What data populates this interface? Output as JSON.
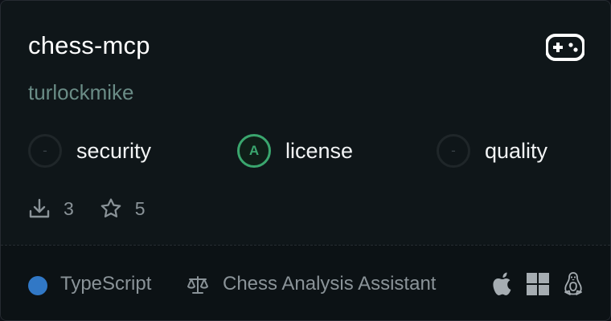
{
  "server": {
    "name": "chess-mcp",
    "author": "turlockmike",
    "category_icon": "gamepad-icon"
  },
  "scores": [
    {
      "grade": "-",
      "label": "security"
    },
    {
      "grade": "A",
      "label": "license"
    },
    {
      "grade": "-",
      "label": "quality"
    }
  ],
  "stats": {
    "downloads": "3",
    "stars": "5"
  },
  "footer": {
    "language": "TypeScript",
    "language_color": "#3178c6",
    "category": "Chess Analysis Assistant",
    "platforms": [
      "apple-icon",
      "windows-icon",
      "linux-icon"
    ]
  },
  "colors": {
    "grade_a": "#3aa66e",
    "author": "#6a8c86"
  }
}
